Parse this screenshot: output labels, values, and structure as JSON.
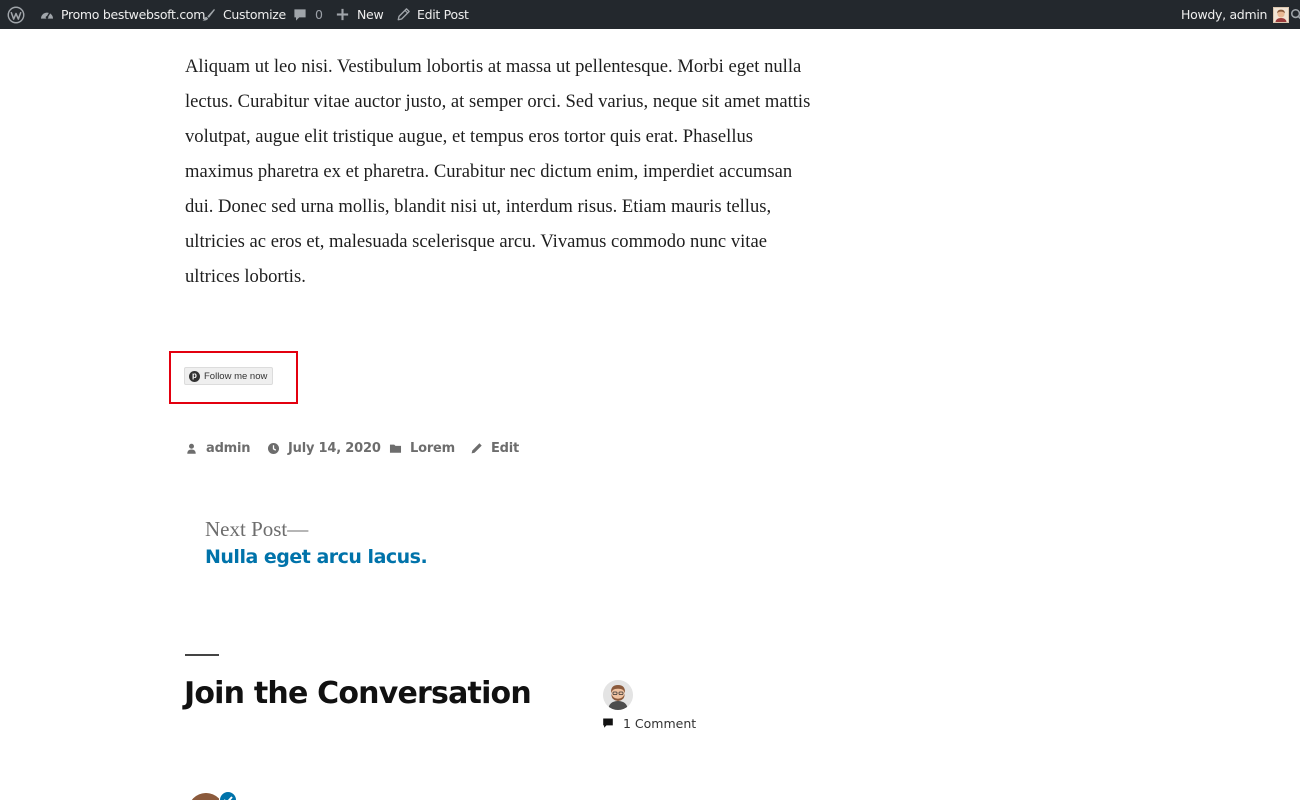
{
  "admin_bar": {
    "wp_logo_icon": "wordpress-logo-icon",
    "site_name": "Promo bestwebsoft.com",
    "customize": "Customize",
    "comments_count": "0",
    "new": "New",
    "edit_post": "Edit Post",
    "greeting": "Howdy, admin"
  },
  "post": {
    "body": "Aliquam ut leo nisi. Vestibulum lobortis at massa ut pellentesque. Morbi eget nulla lectus. Curabitur vitae auctor justo, at semper orci. Sed varius, neque sit amet mattis volutpat, augue elit tristique augue, et tempus eros tortor quis erat. Phasellus maximus pharetra ex et pharetra. Curabitur nec dictum enim, imperdiet accumsan dui. Donec sed urna mollis, blandit nisi ut, interdum risus. Etiam mauris tellus, ultricies ac eros et, malesuada scelerisque arcu. Vivamus commodo nunc vitae ultrices lobortis.",
    "follow_button": "Follow me now",
    "meta": {
      "author": "admin",
      "date": "July 14, 2020",
      "category": "Lorem",
      "edit": "Edit"
    }
  },
  "post_nav": {
    "kicker": "Next Post—",
    "title": "Nulla eget arcu lacus."
  },
  "comments": {
    "heading": "Join the Conversation",
    "count_label": "1 Comment"
  },
  "colors": {
    "admin_bar_bg": "#23282d",
    "link_blue": "#0073aa",
    "highlight_red": "#e3000f",
    "meta_gray": "#6d6d6d"
  }
}
